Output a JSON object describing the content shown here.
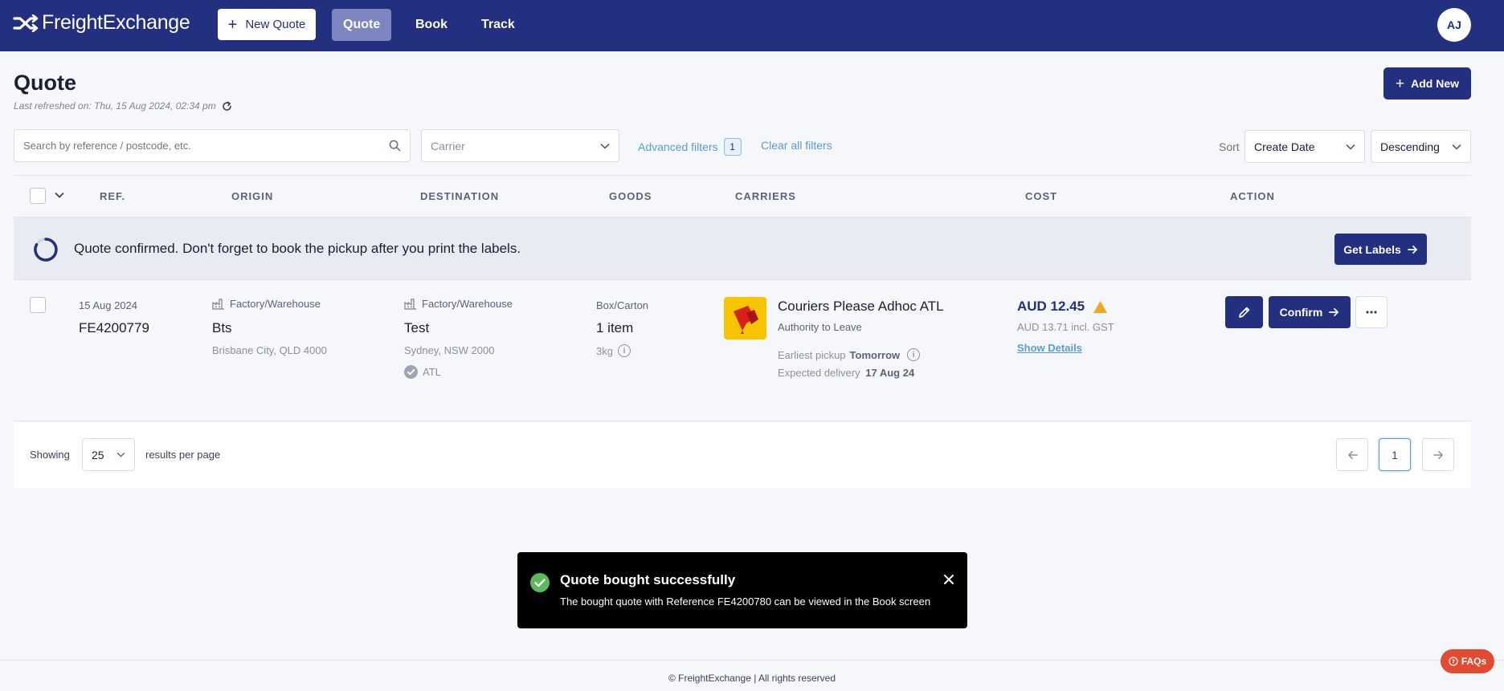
{
  "app": {
    "brand": "FreightExchange",
    "new_quote_label": "New Quote",
    "nav": [
      {
        "label": "Quote",
        "active": true
      },
      {
        "label": "Book",
        "active": false
      },
      {
        "label": "Track",
        "active": false
      }
    ],
    "avatar_initials": "AJ"
  },
  "page": {
    "title": "Quote",
    "last_refreshed": "Last refreshed on: Thu, 15 Aug 2024, 02:34 pm",
    "add_new_label": "Add New"
  },
  "filters": {
    "search_placeholder": "Search by reference / postcode, etc.",
    "carrier_placeholder": "Carrier",
    "advanced_label": "Advanced filters",
    "advanced_count": "1",
    "clear_label": "Clear all filters",
    "sort_label": "Sort",
    "sort_field": "Create Date",
    "sort_direction": "Descending"
  },
  "table": {
    "columns": [
      "REF.",
      "ORIGIN",
      "DESTINATION",
      "GOODS",
      "CARRIERS",
      "COST",
      "ACTION"
    ],
    "banner": {
      "message": "Quote confirmed. Don't forget to book the pickup after you print the labels.",
      "button_label": "Get Labels"
    },
    "row": {
      "date": "15 Aug 2024",
      "ref": "FE4200779",
      "origin_type": "Factory/Warehouse",
      "origin_name": "Bts",
      "origin_address": "Brisbane City, QLD 4000",
      "dest_type": "Factory/Warehouse",
      "dest_name": "Test",
      "dest_address": "Sydney, NSW 2000",
      "dest_flag": "ATL",
      "goods_type": "Box/Carton",
      "goods_count": "1 item",
      "goods_weight": "3kg",
      "carrier_name": "Couriers Please Adhoc ATL",
      "carrier_service": "Authority to Leave",
      "pickup_label": "Earliest pickup",
      "pickup_value": "Tomorrow",
      "delivery_label": "Expected delivery",
      "delivery_value": "17 Aug 24",
      "cost": "AUD 12.45",
      "cost_gst": "AUD 13.71 incl. GST",
      "show_details": "Show Details",
      "confirm_label": "Confirm"
    }
  },
  "pagination": {
    "showing_label": "Showing",
    "per_page": "25",
    "per_page_suffix": "results per page",
    "current_page": "1"
  },
  "toast": {
    "title": "Quote bought successfully",
    "message": "The bought quote with Reference FE4200780 can be viewed in the Book screen"
  },
  "footer": {
    "copyright": "© FreightExchange | All rights reserved",
    "faqs_label": "FAQs"
  },
  "colors": {
    "primary": "#23307f",
    "link": "#5b9bd5",
    "warning": "#f5a623",
    "success": "#5cb85c",
    "faqs": "#e24b32"
  }
}
